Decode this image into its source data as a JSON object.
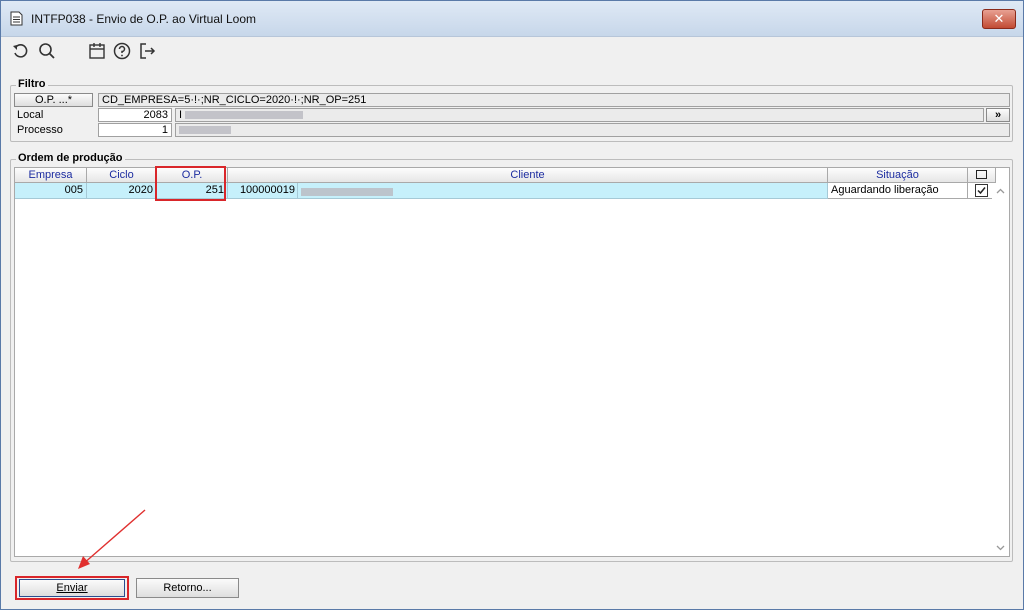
{
  "window": {
    "title": "INTFP038 - Envio de O.P. ao Virtual Loom",
    "close_label": "✕"
  },
  "toolbar": {
    "icons": [
      "undo-icon",
      "search-icon",
      "calendar-icon",
      "help-icon",
      "exit-icon"
    ]
  },
  "filtro": {
    "group_label": "Filtro",
    "op_button_label": "O.P. ...*",
    "op_filter_value": "CD_EMPRESA=5·!·;NR_CICLO=2020·!·;NR_OP=251",
    "local_label": "Local",
    "local_value": "2083",
    "local_desc_prefix": "I",
    "local_lookup_label": "»",
    "processo_label": "Processo",
    "processo_value": "1"
  },
  "ordem": {
    "group_label": "Ordem de produção",
    "columns": {
      "empresa": "Empresa",
      "ciclo": "Ciclo",
      "op": "O.P.",
      "cliente": "Cliente",
      "situacao": "Situação"
    },
    "rows": [
      {
        "empresa": "005",
        "ciclo": "2020",
        "op": "251",
        "cliente_code": "100000019",
        "situacao": "Aguardando liberação",
        "selected": true
      }
    ]
  },
  "actions": {
    "enviar_label": "Enviar",
    "retorno_label": "Retorno..."
  },
  "colors": {
    "selected_row": "#c6f0fb",
    "highlight": "#d9262a",
    "header_text": "#1c2ca0"
  }
}
